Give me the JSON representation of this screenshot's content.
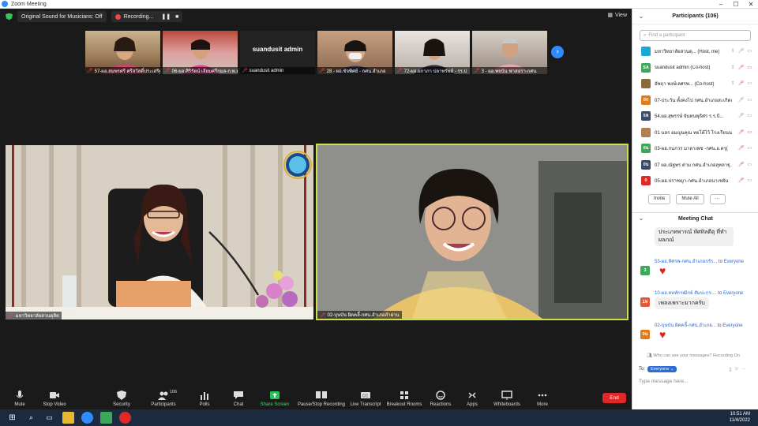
{
  "window": {
    "title": "Zoom Meeting",
    "minimize": "–",
    "maximize": "☐",
    "close": "✕"
  },
  "topbar": {
    "audio_label": "Original Sound for Musicians: Off",
    "recording_label": "Recording...",
    "pause_icon": "❚❚",
    "stop_icon": "■",
    "view_label": "View"
  },
  "thumbnails": [
    {
      "name": "57-ผอ.สมพรศรี ศรีสวัสดิ์ประเสริฐ",
      "muted": true
    },
    {
      "name": "06-ผอ.ศิริรัตน์ เจียมศรีกมล-ก.พ.ม.",
      "muted": true
    },
    {
      "name": "suandusit admin",
      "caption": "suandusit admin",
      "muted": true
    },
    {
      "name": "28 - ผอ.ขัจพิศย์ - กศน.อำเภอ",
      "muted": true
    },
    {
      "name": "72-ผอ.ผกาภา ปลาทรัพย์ - รร.ป",
      "muted": true
    },
    {
      "name": "3 - ผอ.พจนัน ฟาสอรา-กศน",
      "muted": true
    }
  ],
  "next_label": "›",
  "tiles": {
    "left_label": "มหาวิทยาลัยสวนดุสิต",
    "right_label": "02-บุษบัน ผิดคลี้-กศน.อำเภอลำผ่าน"
  },
  "toolbar": [
    {
      "label": "Mute",
      "icon": "mic-icon"
    },
    {
      "label": "Stop Video",
      "icon": "camera-icon"
    },
    {
      "label": "Security",
      "icon": "shield-icon"
    },
    {
      "label": "Participants",
      "icon": "people-icon",
      "count": "106"
    },
    {
      "label": "Polls",
      "icon": "chart-icon"
    },
    {
      "label": "Chat",
      "icon": "chat-icon"
    },
    {
      "label": "Share Screen",
      "icon": "share-icon"
    },
    {
      "label": "Pause/Stop Recording",
      "icon": "record-icon"
    },
    {
      "label": "Live Transcript",
      "icon": "cc-icon"
    },
    {
      "label": "Breakout Rooms",
      "icon": "grid-icon"
    },
    {
      "label": "Reactions",
      "icon": "smile-icon"
    },
    {
      "label": "Apps",
      "icon": "apps-icon"
    },
    {
      "label": "Whiteboards",
      "icon": "whiteboard-icon"
    },
    {
      "label": "More",
      "icon": "dots-icon"
    }
  ],
  "end_label": "End",
  "participants": {
    "title": "Participants (106)",
    "search_placeholder": "Find a participant",
    "items": [
      {
        "initials": "",
        "name": "มหาวิทยาลัยสวนดุ... (Host, me)",
        "color": "#1ba8d8"
      },
      {
        "initials": "SA",
        "name": "suandusit admin (Co-host)",
        "color": "#3da858"
      },
      {
        "initials": "",
        "name": "อัพฤา พงษ์เลศรพ... (Co-host)",
        "color": "#8a6a3a"
      },
      {
        "initials": "0ก",
        "name": "07-ประวัน ตั้งคงไป กศน.อำเภอสะเกิดเซ...",
        "color": "#e07a1a"
      },
      {
        "initials": "5ห",
        "name": "54.ผอ.สุพรรษ์ จันทนพุธิศร ร.ร.ป้...",
        "color": "#3a4a6a"
      },
      {
        "initials": "",
        "name": "01 นลร อมญนคุณ ทยโต้ไว้ โรงเรียนน...",
        "color": "#b08050"
      },
      {
        "initials": "0น",
        "name": "03-ผอ.กนกวร มาลาเพช -กศน.อ.ตรุ(",
        "color": "#3da858"
      },
      {
        "initials": "0น",
        "name": "07 ผอ.ณัฐพร ต่าม กศน.อำเภอลุทลาฐุ...",
        "color": "#3a4a6a"
      },
      {
        "initials": "0",
        "name": "05-ผอ.ปราชญา-กศน.อำเภอนาเชยัน",
        "color": "#e02828"
      }
    ],
    "invite_label": "Invite",
    "mute_all_label": "Mute All",
    "more_label": "···"
  },
  "chat": {
    "title": "Meeting Chat",
    "messages": [
      {
        "bubble": "ประเภทพารณ์ ทัศทิลตีตุ ที่ทำผลภณ์"
      },
      {
        "sender": "53-ผอ.ทิศรพ-กศน.อำเภอกรัร...",
        "to_label": " to ",
        "to": "Everyone",
        "initials": "3",
        "avatar_color": "#3da858",
        "heart": "♥"
      },
      {
        "sender": "10-ผอ.ทลทักรฒิกย์ สัมปะกร-...",
        "to_label": " to ",
        "to": "Everyone",
        "initials": "1ห",
        "avatar_color": "#e05a3a",
        "bubble": "เพลงเพราะมากครับ"
      },
      {
        "sender": "02-บุษบัน ผิดคลี้-กศน.อำเภอ...",
        "to_label": " to ",
        "to": "Everyone",
        "initials": "0น",
        "avatar_color": "#e07a1a",
        "heart": "♥"
      }
    ],
    "visibility_note": "Who can see your messages? Recording On",
    "to_label": "To:",
    "to_value": "Everyone ⌄",
    "input_placeholder": "Type message here..."
  },
  "taskbar": {
    "time": "10:51 AM",
    "date": "11/4/2022"
  }
}
